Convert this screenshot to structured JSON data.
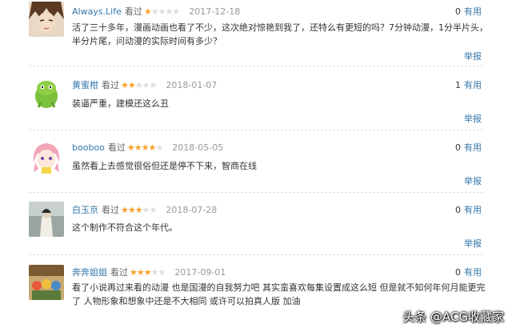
{
  "comments": [
    {
      "username": "Always.Life",
      "verb": "看过",
      "rating": 1,
      "date": "2017-12-18",
      "useful_count": "0",
      "useful_label": "有用",
      "text": "活了三十多年，漫画动画也看了不少，这次绝对惊艳到我了，还特么有更短的吗？7分钟动漫，1分半片头，半分片尾，问动漫的实际时间有多少？",
      "report_label": "举报"
    },
    {
      "username": "黄蜜柑",
      "verb": "看过",
      "rating": 2,
      "date": "2018-01-07",
      "useful_count": "1",
      "useful_label": "有用",
      "text": "装逼严重，建模还这么丑",
      "report_label": "举报"
    },
    {
      "username": "booboo",
      "verb": "看过",
      "rating": 4,
      "date": "2018-05-05",
      "useful_count": "0",
      "useful_label": "有用",
      "text": "虽然看上去感觉很俗但还是停不下来，智商在线",
      "report_label": "举报"
    },
    {
      "username": "白玉京",
      "verb": "看过",
      "rating": 3,
      "date": "2018-07-28",
      "useful_count": "0",
      "useful_label": "有用",
      "text": "这个制作不符合这个年代。",
      "report_label": "举报"
    },
    {
      "username": "奔奔姐姐",
      "verb": "看过",
      "rating": 3,
      "date": "2017-09-01",
      "useful_count": "0",
      "useful_label": "有用",
      "text": "看了小说再过来看的动漫 也是国漫的自我努力吧 其实蛮喜欢每集设置成这么短 但是就不知何年何月能更完了 人物形象和想象中还是不大相同 或许可以拍真人版 加油",
      "report_label": "举报"
    }
  ],
  "watermark": {
    "text": "头条 @ACG收藏家"
  },
  "colors": {
    "link": "#3377aa",
    "star_on": "#f7a227",
    "star_off": "#dddddd"
  }
}
